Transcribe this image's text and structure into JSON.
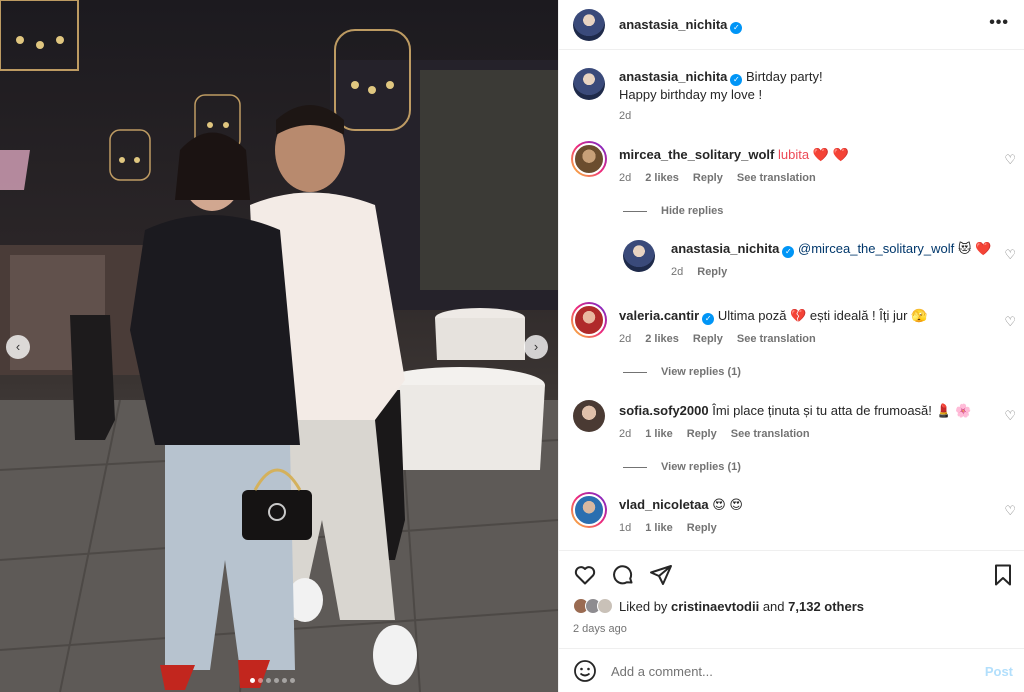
{
  "post": {
    "author": "anastasia_nichita",
    "caption_line1": "Birtday party!",
    "caption_line2": "Happy birthday my love !",
    "caption_age": "2d"
  },
  "header": {
    "username": "anastasia_nichita",
    "more_label": "•••"
  },
  "carousel": {
    "prev": "‹",
    "next": "›",
    "slides": 6,
    "active_slide": 1
  },
  "comments": [
    {
      "user": "mircea_the_solitary_wolf",
      "text": "lubita ❤️ ❤️",
      "age": "2d",
      "likes": "2 likes",
      "reply": "Reply",
      "translate": "See translation"
    },
    {
      "user": "valeria.cantir",
      "text": "Ultima poză 💔 ești ideală ! Îți jur 🫣",
      "age": "2d",
      "likes": "2 likes",
      "reply": "Reply",
      "translate": "See translation"
    },
    {
      "user": "sofia.sofy2000",
      "text": "Îmi place ținuta și tu atta de frumoasă! 💄 🌸",
      "age": "2d",
      "likes": "1 like",
      "reply": "Reply",
      "translate": "See translation"
    },
    {
      "user": "vlad_nicoletaa",
      "text": "😍 😍",
      "age": "1d",
      "likes": "1 like",
      "reply": "Reply"
    }
  ],
  "hide_replies": "Hide replies",
  "reply": {
    "user": "anastasia_nichita",
    "mention": "@mircea_the_solitary_wolf",
    "emoji": "😻 ❤️",
    "age": "2d",
    "reply": "Reply"
  },
  "view_replies_1": "View replies (1)",
  "view_replies_2": "View replies (1)",
  "liked_by": {
    "prefix": "Liked by",
    "user": "cristinaevtodii",
    "and": "and",
    "count": "7,132 others"
  },
  "post_date": "2 days ago",
  "comment_input": {
    "placeholder": "Add a comment..."
  },
  "post_button": "Post",
  "icons": [
    "heart-icon",
    "comment-icon",
    "share-icon",
    "bookmark-icon",
    "emoji-icon",
    "verified-icon"
  ],
  "colors": {
    "verified": "#0095f6",
    "post_disabled": "#b2dffc",
    "muted": "#737373",
    "heart_red": "#ed4956"
  }
}
